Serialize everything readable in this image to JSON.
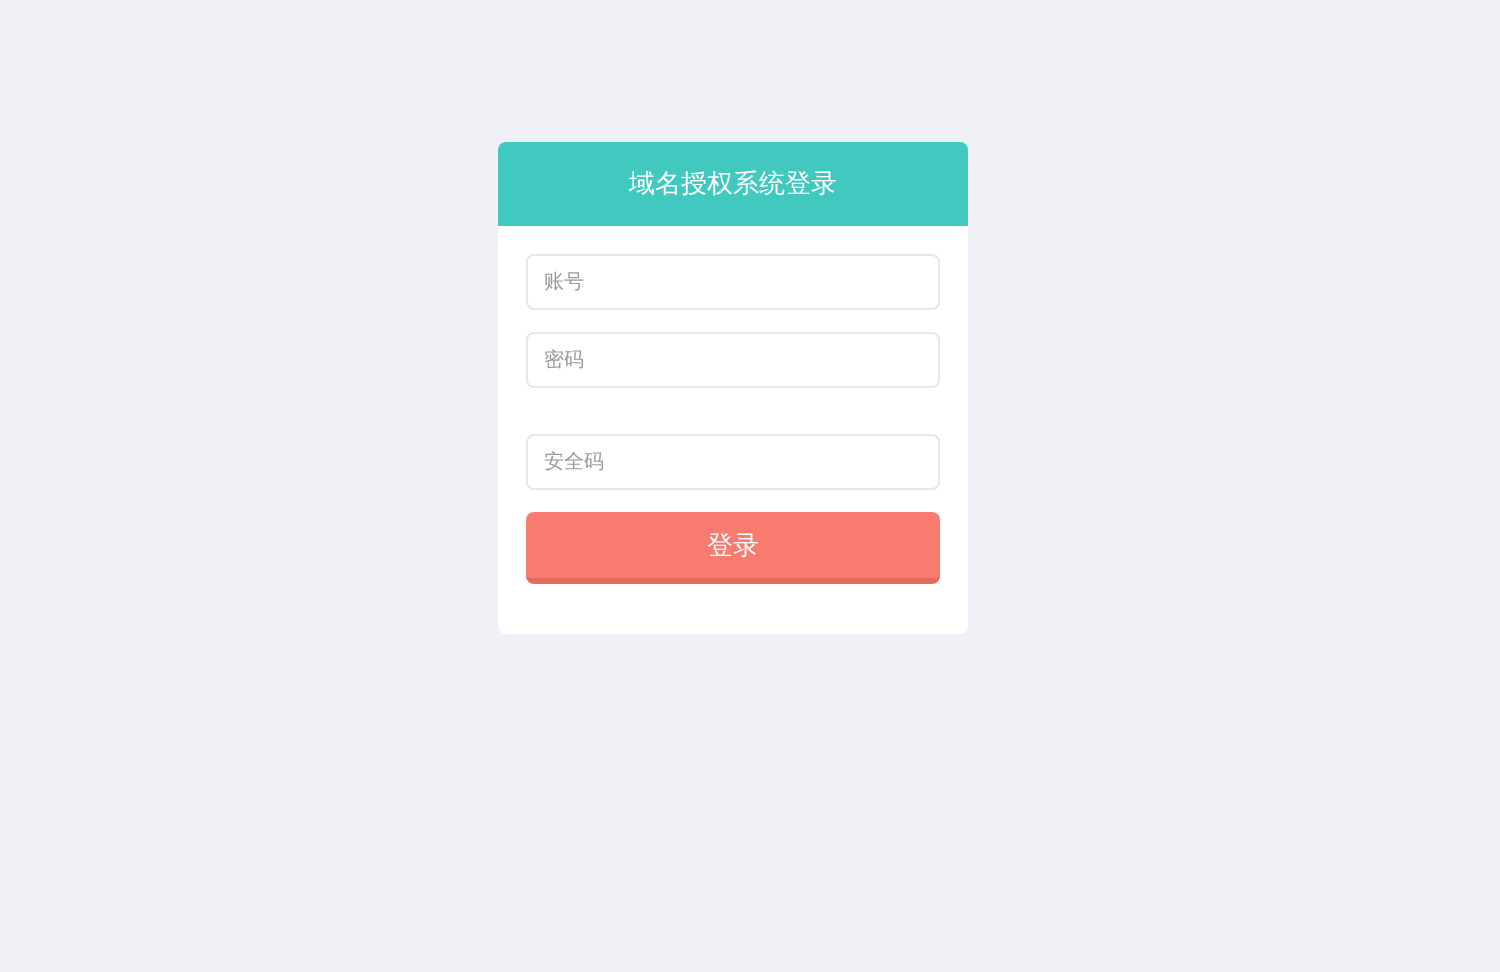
{
  "card": {
    "title": "域名授权系统登录"
  },
  "fields": [
    {
      "placeholder": "账号"
    },
    {
      "placeholder": "密码"
    },
    {
      "placeholder": "安全码"
    }
  ],
  "login_button": "登录"
}
